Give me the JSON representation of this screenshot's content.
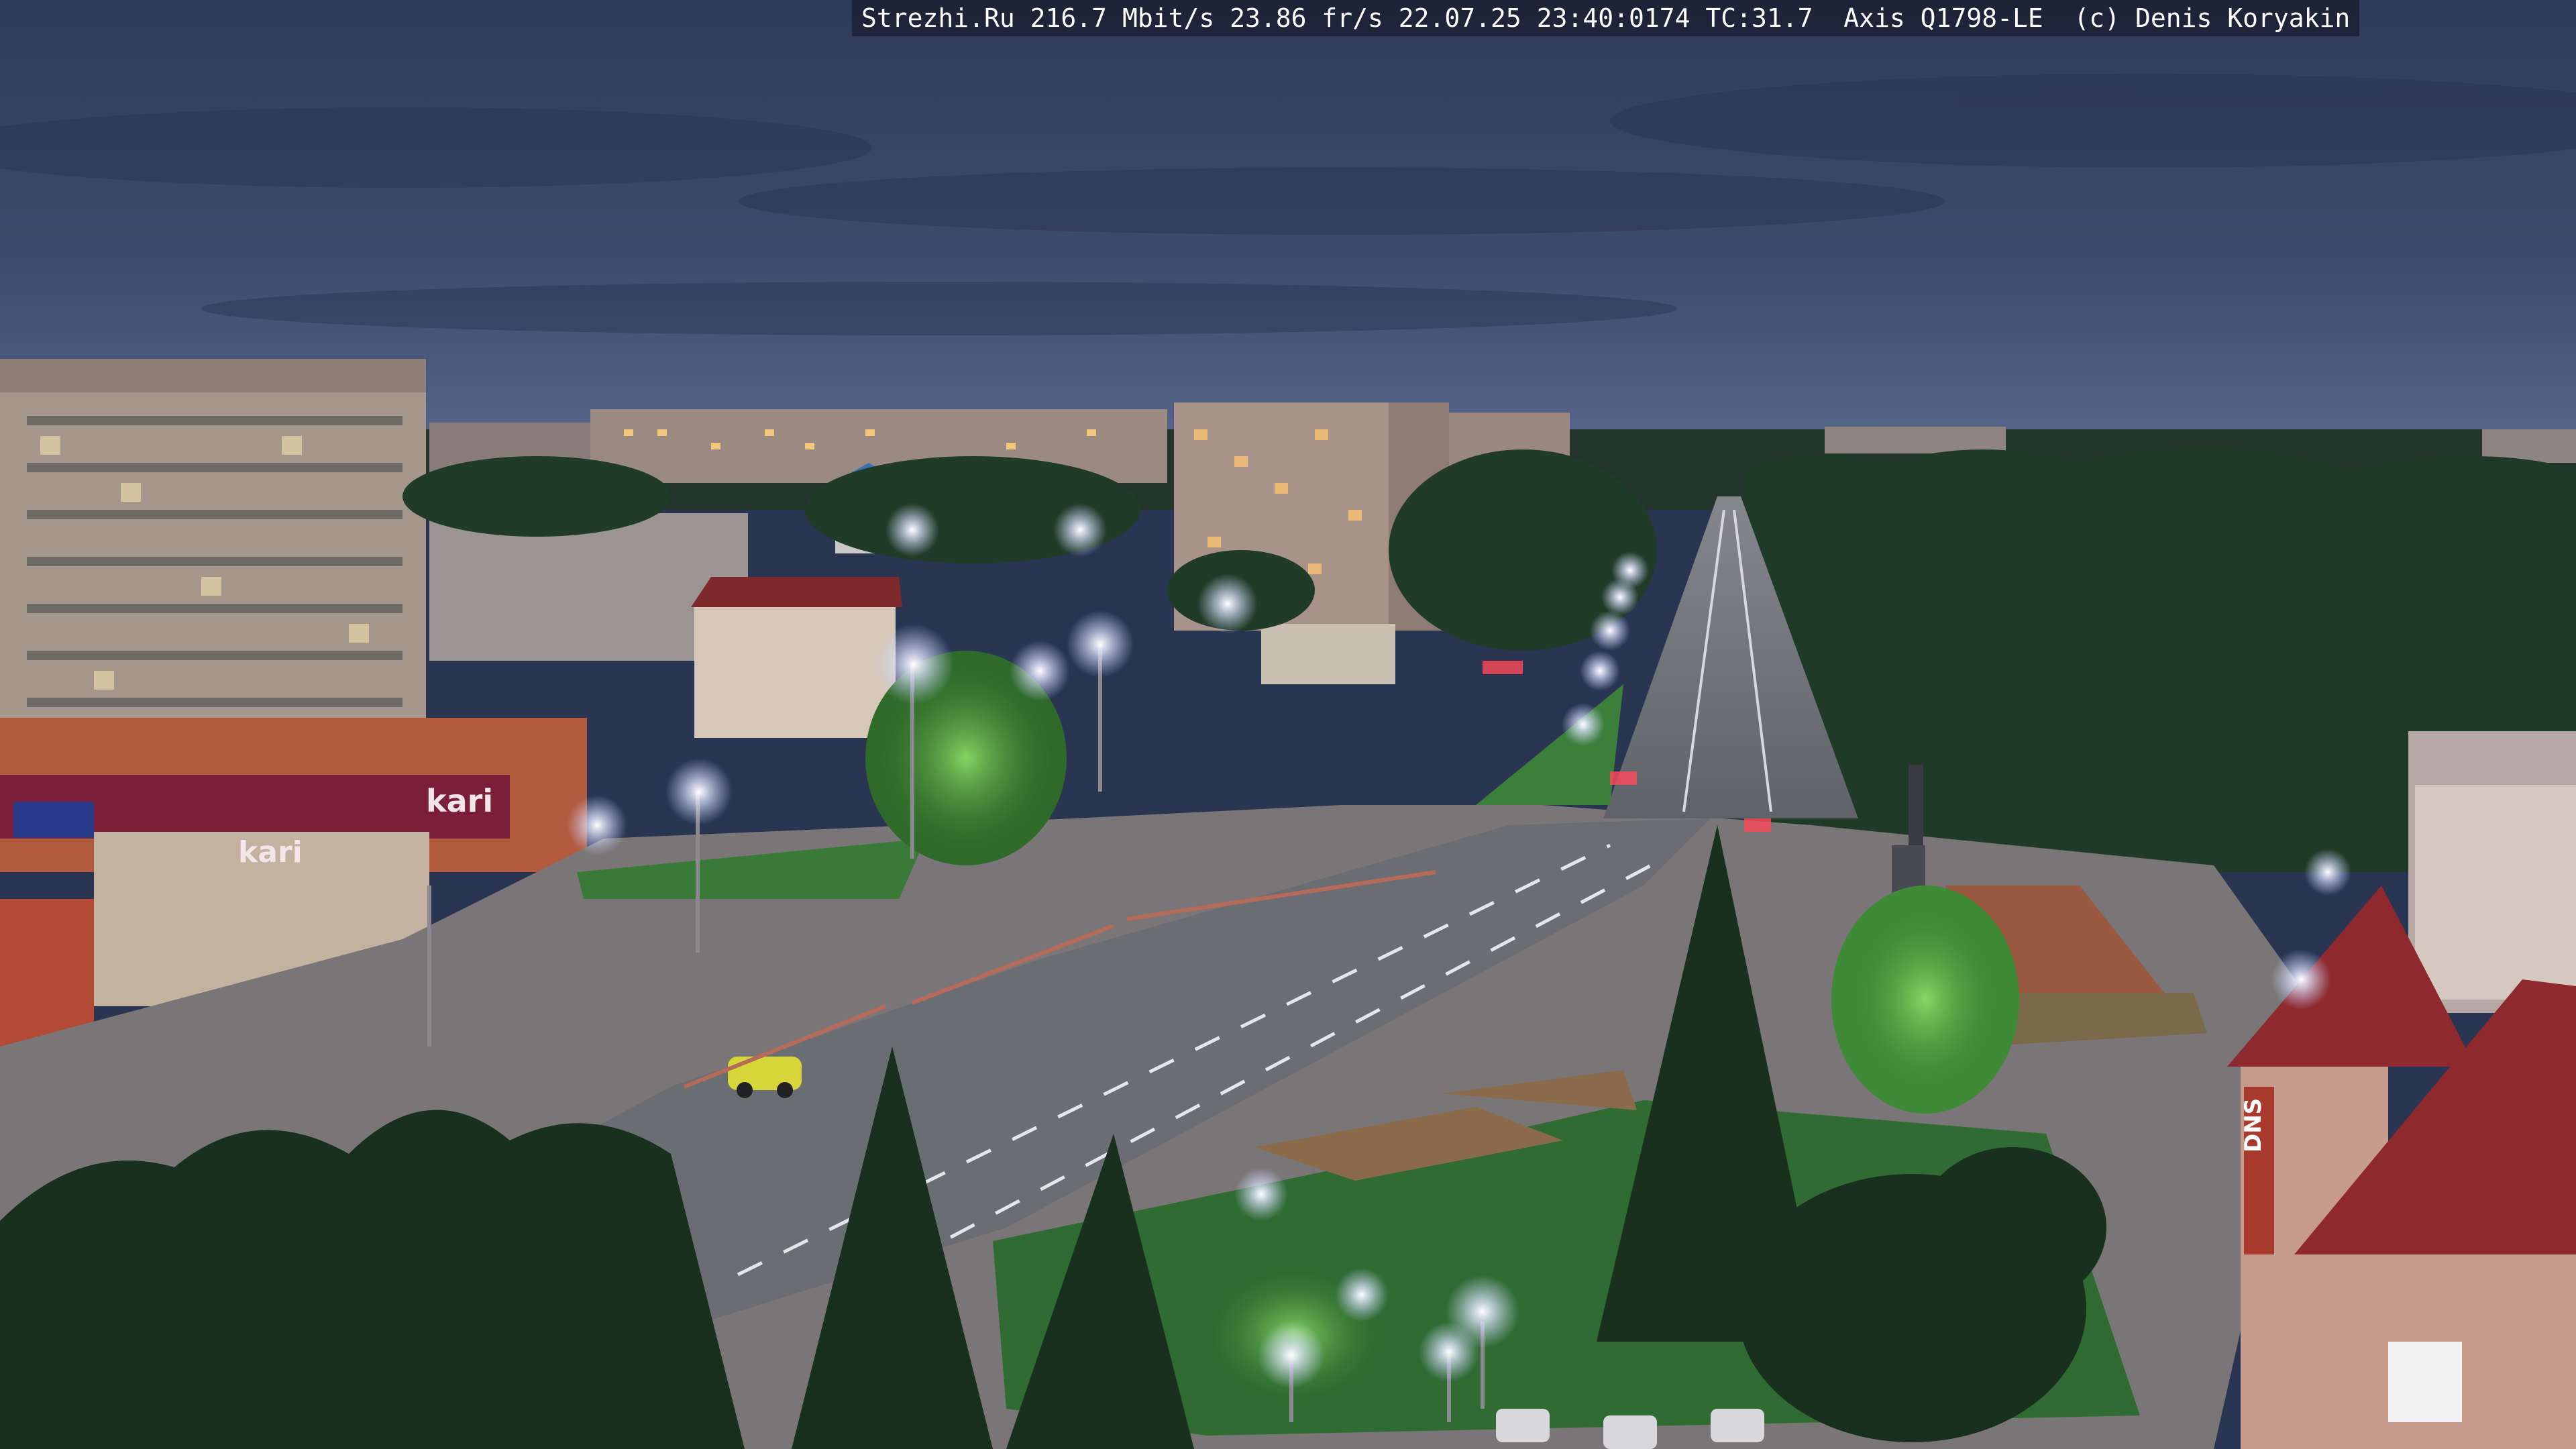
{
  "overlay": {
    "site": "Strezhi.Ru",
    "bandwidth": "216.7 Mbit/s",
    "framerate": "23.86 fr/s",
    "date": "22.07.25",
    "time": "23:40:0174",
    "temperature": "TC:31.7",
    "camera_model": "Axis Q1798-LE",
    "copyright": "(c) Denis Koryakin"
  },
  "signs": {
    "store_left": "kari",
    "store_left_upper": "kari",
    "store_right": "DNS"
  },
  "colors": {
    "sky_top": "#34415f",
    "sky_horizon": "#4a5a7c",
    "foliage": "#1f3a26",
    "foliage_lit": "#5fb84a",
    "asphalt": "#6c7077",
    "lamp": "#e8eaff",
    "roof_red": "#8e2a2e"
  }
}
